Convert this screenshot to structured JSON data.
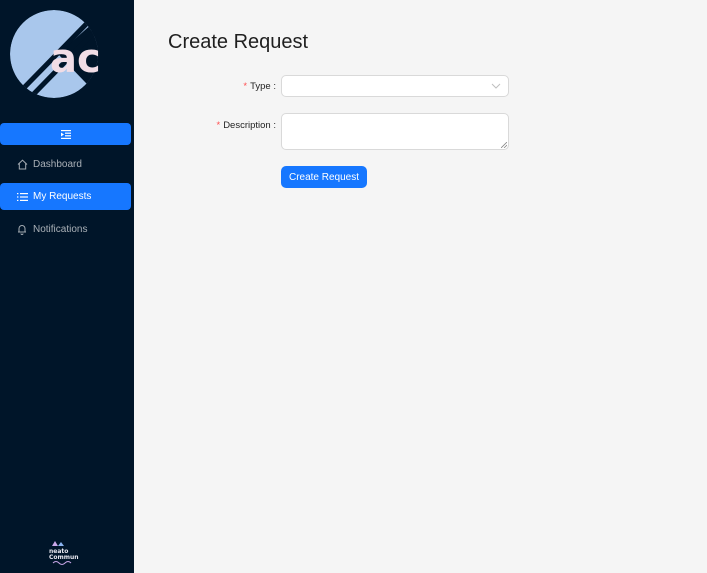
{
  "sidebar": {
    "menu": [
      {
        "label": "Dashboard",
        "icon": "home-icon"
      },
      {
        "label": "My Requests",
        "icon": "list-icon"
      },
      {
        "label": "Notifications",
        "icon": "bell-icon"
      }
    ],
    "logo_text": "ac",
    "footer_logo_text_1": "neato",
    "footer_logo_text_2": "Commun"
  },
  "page": {
    "title": "Create Request"
  },
  "form": {
    "type_label": "Type",
    "description_label": "Description",
    "required_mark": "*",
    "type_value": "",
    "description_value": "",
    "submit_label": "Create Request"
  },
  "colors": {
    "sidebar_bg": "#001529",
    "accent": "#1677ff",
    "required": "#ff4d4f",
    "content_bg": "#f5f5f5"
  }
}
